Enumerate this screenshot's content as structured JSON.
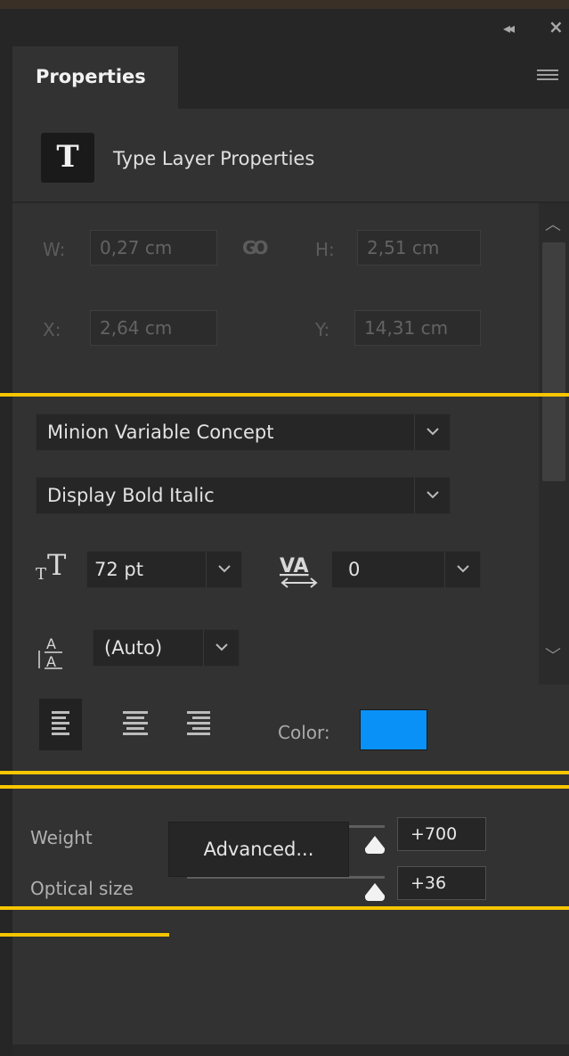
{
  "panel": {
    "tab_label": "Properties",
    "section_title": "Type Layer Properties",
    "type_icon_glyph": "T"
  },
  "transform": {
    "w_label": "W:",
    "w_value": "0,27 cm",
    "h_label": "H:",
    "h_value": "2,51 cm",
    "x_label": "X:",
    "x_value": "2,64 cm",
    "y_label": "Y:",
    "y_value": "14,31 cm",
    "link_icon": "link-icon"
  },
  "character": {
    "font_family": "Minion Variable Concept",
    "font_style": "Display Bold Italic",
    "font_size": "72 pt",
    "tracking": "0",
    "leading": "(Auto)",
    "tracking_glyph": "VA"
  },
  "paragraph": {
    "color_label": "Color:",
    "color_value": "#0a91f7",
    "active_alignment": "left"
  },
  "variable_axes": [
    {
      "label": "Weight",
      "value": "+700",
      "position": 0.93
    },
    {
      "label": "Optical size",
      "value": "+36",
      "position": 0.93
    }
  ],
  "advanced_button": "Advanced...",
  "highlight_color": "#f7c600"
}
